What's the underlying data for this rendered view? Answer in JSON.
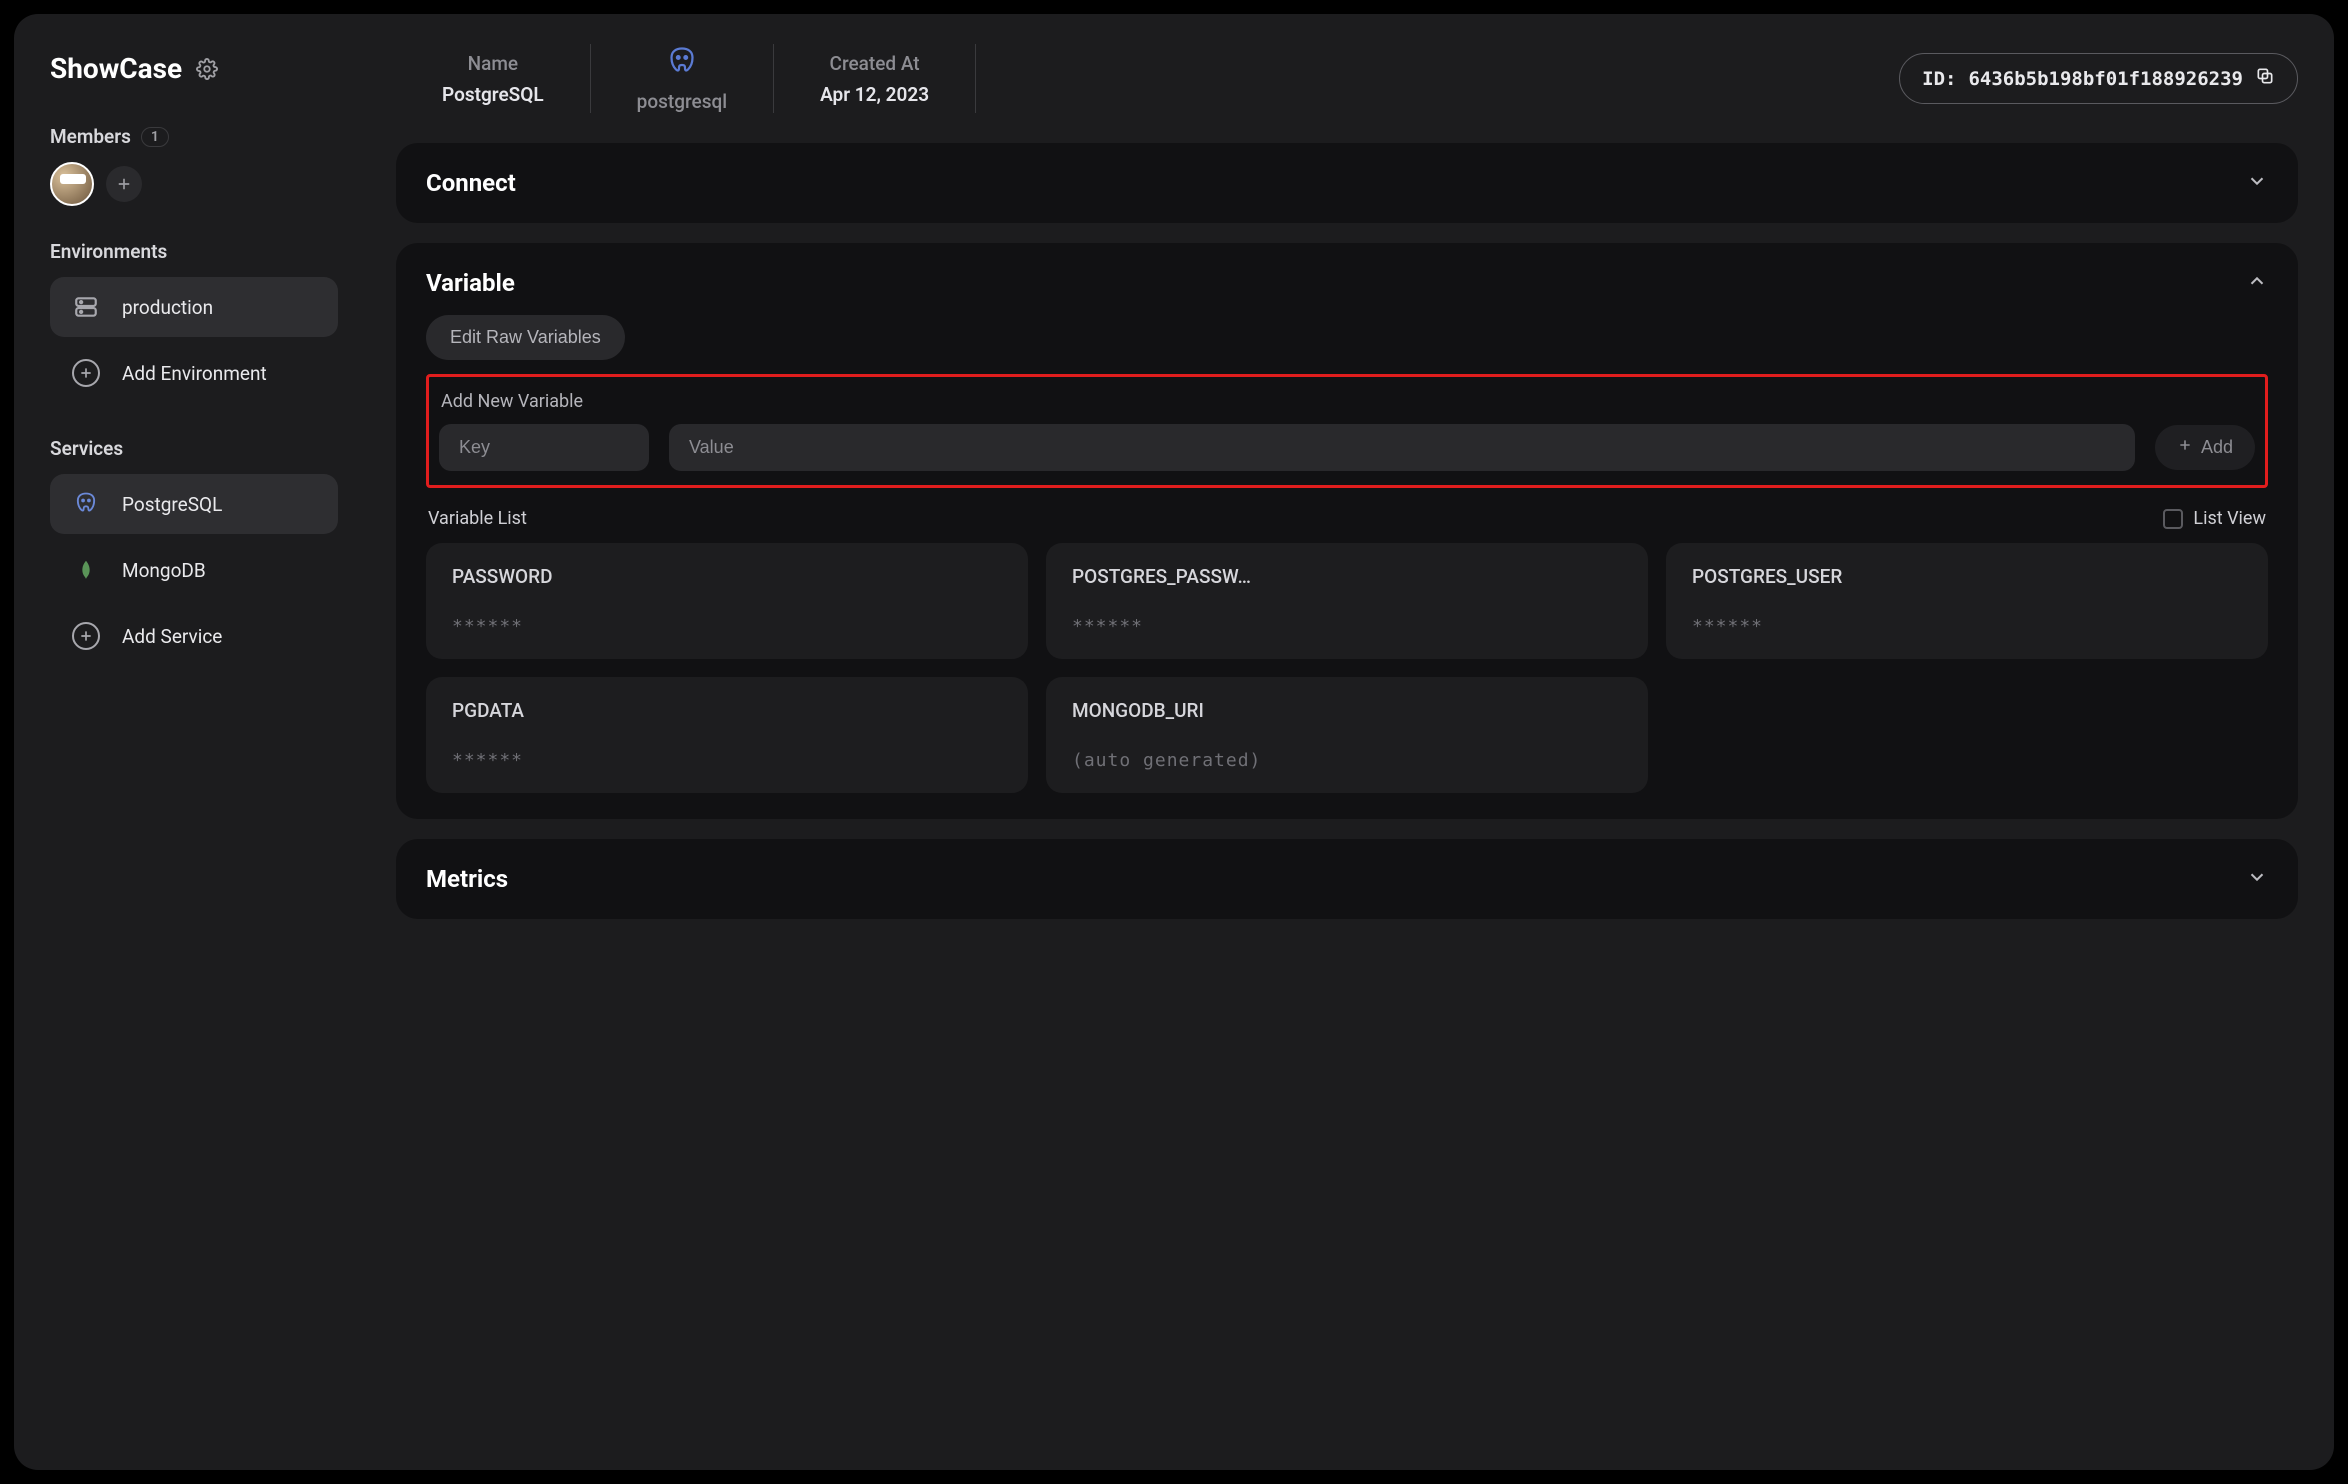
{
  "workspace": {
    "name": "ShowCase"
  },
  "members": {
    "label": "Members",
    "count": "1"
  },
  "environments": {
    "label": "Environments",
    "items": [
      {
        "label": "production",
        "active": true
      }
    ],
    "add_label": "Add Environment"
  },
  "services": {
    "label": "Services",
    "items": [
      {
        "label": "PostgreSQL",
        "active": true,
        "icon": "postgres"
      },
      {
        "label": "MongoDB",
        "active": false,
        "icon": "mongodb"
      }
    ],
    "add_label": "Add Service"
  },
  "header": {
    "name_label": "Name",
    "name_value": "PostgreSQL",
    "logo_sub": "postgresql",
    "created_label": "Created At",
    "created_value": "Apr 12, 2023",
    "id_prefix": "ID:",
    "id_value": "6436b5b198bf01f188926239"
  },
  "panels": {
    "connect": {
      "title": "Connect"
    },
    "variable": {
      "title": "Variable",
      "edit_btn": "Edit Raw Variables",
      "add_label": "Add New Variable",
      "key_placeholder": "Key",
      "value_placeholder": "Value",
      "add_btn": "Add",
      "list_title": "Variable List",
      "list_view": "List View",
      "items": [
        {
          "name": "PASSWORD",
          "value": "******"
        },
        {
          "name": "POSTGRES_PASSW…",
          "value": "******"
        },
        {
          "name": "POSTGRES_USER",
          "value": "******"
        },
        {
          "name": "PGDATA",
          "value": "******"
        },
        {
          "name": "MONGODB_URI",
          "value": "(auto generated)"
        }
      ]
    },
    "metrics": {
      "title": "Metrics"
    }
  }
}
